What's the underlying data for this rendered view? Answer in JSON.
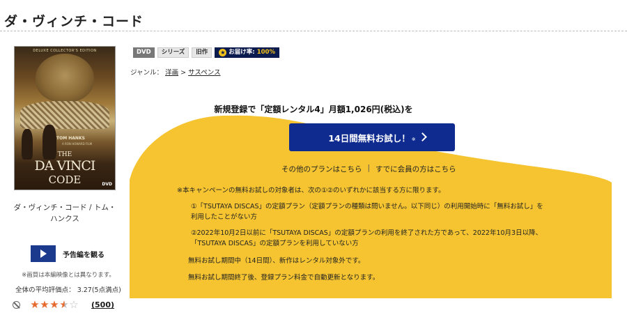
{
  "product": {
    "title": "ダ・ヴィンチ・コード",
    "caption": "ダ・ヴィンチ・コード / トム・ハンクス",
    "jacket": {
      "edition": "DELUXE COLLECTOR'S EDITION",
      "actor": "TOM HANKS",
      "actor_sub": "A RON HOWARD FILM",
      "title_line1": "THE",
      "title_line2": "DA VINCI",
      "title_line3": "CODE",
      "format": "DVD"
    }
  },
  "badges": {
    "format": "DVD",
    "series": "シリーズ",
    "old": "旧作",
    "delivery_icon": "★",
    "delivery_label": "お届け率:",
    "delivery_rate": "100%"
  },
  "genre": {
    "prefix": "ジャンル：",
    "level1": "洋画",
    "sep": ">",
    "level2": "サスペンス"
  },
  "sidebar": {
    "trailer_label": "予告編を観る",
    "image_note": "※画質は本編映像とは異なります。",
    "rating_text": "全体の平均評価点： 3.27(5点満点)",
    "rating_value": 3.27,
    "rating_max": 5,
    "review_count": "(500)"
  },
  "campaign": {
    "headline": "新規登録で「定額レンタル4」月額1,026円(税込)を",
    "cta_label": "14日間無料お試し！",
    "cta_mark": "※",
    "other_plans": "その他のプランはこちら",
    "separator": "|",
    "members": "すでに会員の方はこちら",
    "terms_intro": "※本キャンペーンの無料お試しの対象者は、次の①②のいずれかに該当する方に限ります。",
    "term1_line1": "①「TSUTAYA DISCAS」の定額プラン（定額プランの種類は問いません。以下同じ）の利用開始時に「無料お試し」を",
    "term1_line2": "利用したことがない方",
    "term2_line1": "②2022年10月2日以前に「TSUTAYA DISCAS」の定額プランの利用を終了された方であって、2022年10月3日以降、",
    "term2_line2": "「TSUTAYA DISCAS」の定額プランを利用していない方",
    "note1": "無料お試し期間中（14日間）、新作はレンタル対象外です。",
    "note2": "無料お試し期間終了後、登録プラン料金で自動更新となります。"
  },
  "colors": {
    "campaign_yellow": "#f5c430",
    "cta_blue": "#0f2b8f",
    "star_orange": "#e66a2e",
    "badge_navy": "#0c1b4d"
  }
}
